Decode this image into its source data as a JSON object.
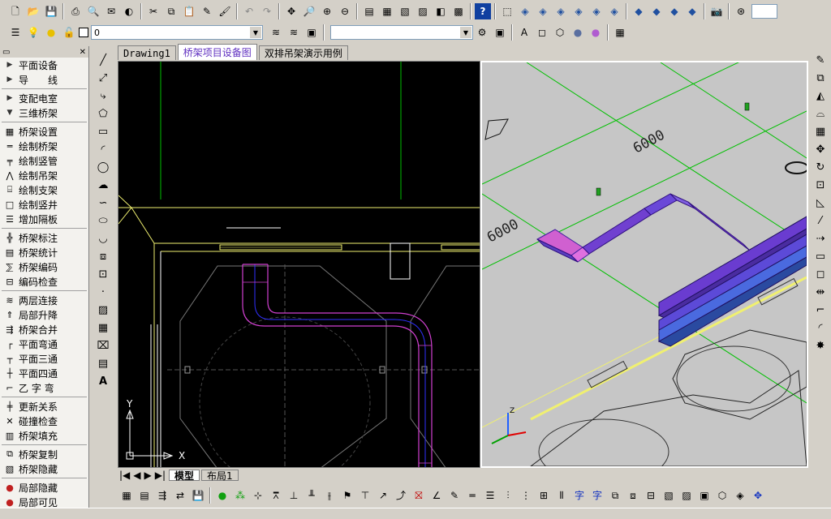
{
  "toolbar1": {
    "icons": [
      "new-icon",
      "open-icon",
      "save-icon",
      "print-icon",
      "preview-icon",
      "publish-icon",
      "globe-icon",
      "cut-icon",
      "copy-icon",
      "paste-icon",
      "match-icon",
      "brush-icon",
      "undo-icon",
      "redo-icon",
      "pan-icon",
      "zoom-realtime-icon",
      "zoom-window-icon",
      "zoom-previous-icon",
      "properties-icon",
      "design-center-icon",
      "tool-palette-icon",
      "sheet-set-icon",
      "markup-icon",
      "calculator-icon",
      "help-icon",
      "ucs-icon",
      "view-top-icon",
      "view-bottom-icon",
      "view-left-icon",
      "view-right-icon",
      "view-front-icon",
      "view-back-icon",
      "iso-sw-icon",
      "iso-se-icon",
      "iso-ne-icon",
      "iso-nw-icon",
      "camera-icon",
      "orbit-icon"
    ]
  },
  "layer_bar": {
    "layer_value": "0",
    "style_value": ""
  },
  "palette": {
    "items": [
      {
        "label": "平面设备",
        "type": "cat",
        "icon": "▶"
      },
      {
        "label": "导　　线",
        "type": "cat",
        "icon": "▶"
      },
      {
        "label": "变配电室",
        "type": "cat",
        "icon": "▶"
      },
      {
        "label": "三维桥架",
        "type": "cat",
        "icon": "▼"
      },
      {
        "label": "桥架设置",
        "type": "item",
        "icon": "▦"
      },
      {
        "label": "绘制桥架",
        "type": "item",
        "icon": "═"
      },
      {
        "label": "绘制竖管",
        "type": "item",
        "icon": "╤"
      },
      {
        "label": "绘制吊架",
        "type": "item",
        "icon": "⋀"
      },
      {
        "label": "绘制支架",
        "type": "item",
        "icon": "⌸"
      },
      {
        "label": "绘制竖井",
        "type": "item",
        "icon": "□"
      },
      {
        "label": "增加隔板",
        "type": "item",
        "icon": "☰"
      },
      {
        "label": "桥架标注",
        "type": "item",
        "icon": "╬"
      },
      {
        "label": "桥架统计",
        "type": "item",
        "icon": "▤"
      },
      {
        "label": "桥架编码",
        "type": "item",
        "icon": "⅀"
      },
      {
        "label": "编码检查",
        "type": "item",
        "icon": "⊟"
      },
      {
        "label": "两层连接",
        "type": "item",
        "icon": "≋"
      },
      {
        "label": "局部升降",
        "type": "item",
        "icon": "⇑"
      },
      {
        "label": "桥架合并",
        "type": "item",
        "icon": "⇶"
      },
      {
        "label": "平面弯通",
        "type": "item",
        "icon": "┌"
      },
      {
        "label": "平面三通",
        "type": "item",
        "icon": "┬"
      },
      {
        "label": "平面四通",
        "type": "item",
        "icon": "┼"
      },
      {
        "label": "乙 字 弯",
        "type": "item",
        "icon": "⌐"
      },
      {
        "label": "更新关系",
        "type": "item",
        "icon": "╪"
      },
      {
        "label": "碰撞检查",
        "type": "item",
        "icon": "✕"
      },
      {
        "label": "桥架填充",
        "type": "item",
        "icon": "▥"
      },
      {
        "label": "桥架复制",
        "type": "item",
        "icon": "⧉"
      },
      {
        "label": "桥架隐藏",
        "type": "item",
        "icon": "▧"
      },
      {
        "label": "局部隐藏",
        "type": "item",
        "icon": "●"
      },
      {
        "label": "局部可见",
        "type": "item",
        "icon": "●"
      }
    ]
  },
  "doc_tabs": [
    {
      "label": "Drawing1",
      "active": false
    },
    {
      "label": "桥架项目设备图",
      "active": true
    },
    {
      "label": "双排吊架演示用例",
      "active": false
    }
  ],
  "drawing": {
    "dim_a": "6000",
    "dim_b": "6000",
    "axis_x": "X",
    "axis_y": "Y",
    "axis_z": "Z"
  },
  "layout_tabs": [
    "模型",
    "布局1"
  ],
  "colors": {
    "grid_green": "#00c000",
    "tray_magenta": "#d040d0",
    "tray_blue": "#3030c0",
    "tray_purple": "#7a40d8",
    "wall_yellow": "#f0f070",
    "model_bg": "#c6c6c6"
  }
}
